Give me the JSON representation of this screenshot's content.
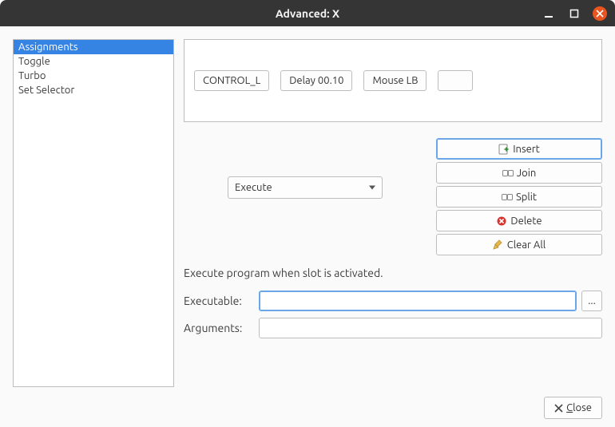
{
  "window": {
    "title": "Advanced: X"
  },
  "sidebar": {
    "items": [
      {
        "label": "Assignments",
        "selected": true
      },
      {
        "label": "Toggle",
        "selected": false
      },
      {
        "label": "Turbo",
        "selected": false
      },
      {
        "label": "Set Selector",
        "selected": false
      }
    ]
  },
  "slots": [
    {
      "label": "CONTROL_L"
    },
    {
      "label": "Delay 00.10"
    },
    {
      "label": "Mouse LB"
    },
    {
      "label": ""
    }
  ],
  "action_combo": {
    "value": "Execute"
  },
  "actions": {
    "insert": "Insert",
    "join": "Join",
    "split": "Split",
    "delete": "Delete",
    "clear_all": "Clear All"
  },
  "description": "Execute program when slot is activated.",
  "form": {
    "executable_label": "Executable:",
    "executable_value": "",
    "arguments_label": "Arguments:",
    "arguments_value": "",
    "browse_label": "..."
  },
  "footer": {
    "close_label": "Close"
  }
}
